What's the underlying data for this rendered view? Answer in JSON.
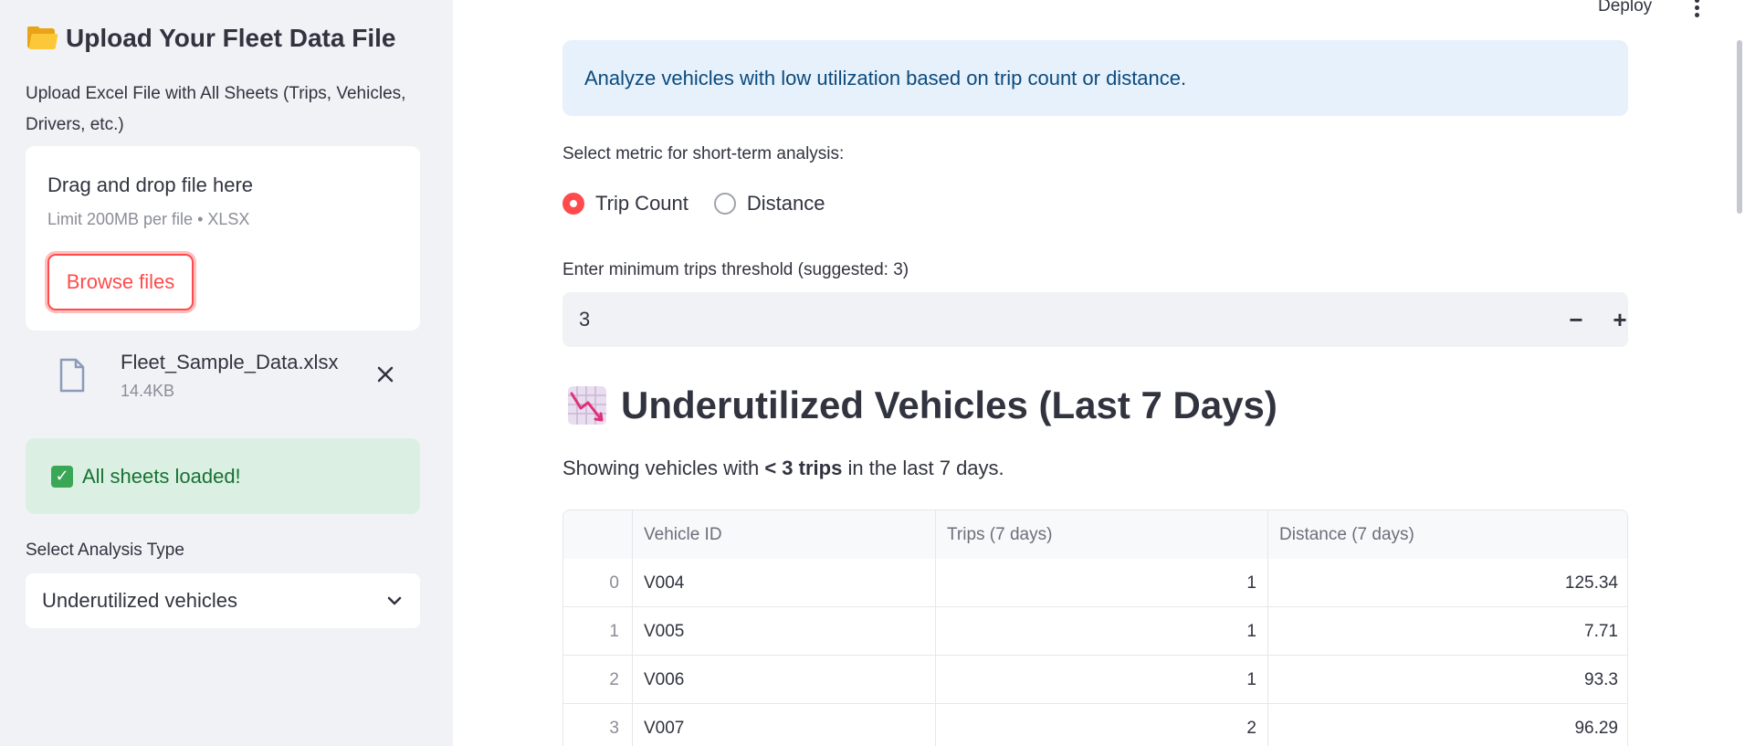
{
  "sidebar": {
    "title": "Upload Your Fleet Data File",
    "upload_label": "Upload Excel File with All Sheets (Trips, Vehicles, Drivers, etc.)",
    "dropzone": {
      "title": "Drag and drop file here",
      "limit": "Limit 200MB per file • XLSX",
      "browse_label": "Browse files"
    },
    "file": {
      "name": "Fleet_Sample_Data.xlsx",
      "size": "14.4KB"
    },
    "success_message": "All sheets loaded!",
    "analysis_label": "Select Analysis Type",
    "analysis_value": "Underutilized vehicles"
  },
  "header": {
    "deploy_label": "Deploy"
  },
  "main": {
    "info": "Analyze vehicles with low utilization based on trip count or distance.",
    "metric_label": "Select metric for short-term analysis:",
    "metric_options": [
      "Trip Count",
      "Distance"
    ],
    "metric_selected": "Trip Count",
    "threshold_label": "Enter minimum trips threshold (suggested: 3)",
    "threshold_value": "3",
    "heading": "Underutilized Vehicles (Last 7 Days)",
    "caption_prefix": "Showing vehicles with ",
    "caption_bold": "< 3 trips",
    "caption_suffix": " in the last 7 days.",
    "table": {
      "columns": [
        "",
        "Vehicle ID",
        "Trips (7 days)",
        "Distance (7 days)"
      ],
      "rows": [
        [
          "0",
          "V004",
          "1",
          "125.34"
        ],
        [
          "1",
          "V005",
          "1",
          "7.71"
        ],
        [
          "2",
          "V006",
          "1",
          "93.3"
        ],
        [
          "3",
          "V007",
          "2",
          "96.29"
        ]
      ]
    }
  },
  "colors": {
    "accent": "#ff4b4b",
    "info_bg": "#e6f1fc",
    "success_bg": "#dbf0e3",
    "sidebar_bg": "#f0f2f6"
  }
}
